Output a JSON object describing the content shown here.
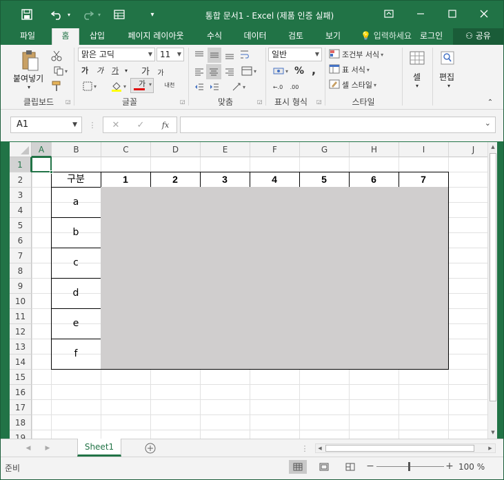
{
  "titlebar": {
    "title": "통합 문서1 - Excel (제품 인증 실패)",
    "icons": [
      "save-icon",
      "undo-icon",
      "redo-icon",
      "form-icon",
      "customize-icon",
      "ribbon-options-icon",
      "minimize-icon",
      "maximize-icon",
      "close-icon"
    ]
  },
  "tabs": [
    "파일",
    "홈",
    "삽입",
    "페이지 레이아웃",
    "수식",
    "데이터",
    "검토",
    "보기"
  ],
  "active_tab": "홈",
  "tell_me": "입력하세요",
  "login": "로그인",
  "share": "공유",
  "ribbon": {
    "clipboard": {
      "paste_label": "붙여넣기",
      "group_label": "클립보드"
    },
    "font": {
      "font_name": "맑은 고딕",
      "font_size": "11",
      "group_label": "글꼴",
      "bold": "가",
      "italic": "가",
      "underline": "가",
      "grow": "가",
      "shrink": "가",
      "font_color_label": "가",
      "phonetic": "내천"
    },
    "alignment": {
      "group_label": "맞춤"
    },
    "number": {
      "format": "일반",
      "percent": "%",
      "comma": ",",
      "inc_decimal": "←.0",
      "dec_decimal": ".00",
      "group_label": "표시 형식"
    },
    "styles": {
      "conditional": "조건부 서식",
      "table": "표 서식",
      "cell": "셀 스타일",
      "group_label": "스타일"
    },
    "cells": {
      "label": "셀"
    },
    "editing": {
      "label": "편집"
    },
    "accent_color": "#217346",
    "font_color_bar": "#e00000"
  },
  "formula_bar": {
    "name_box": "A1",
    "cancel": "✕",
    "enter": "✓",
    "fx": "fx",
    "formula": ""
  },
  "grid": {
    "columns": [
      "A",
      "B",
      "C",
      "D",
      "E",
      "F",
      "G",
      "H",
      "I",
      "J"
    ],
    "rows": [
      "1",
      "2",
      "3",
      "4",
      "5",
      "6",
      "7",
      "8",
      "9",
      "10",
      "11",
      "12",
      "13",
      "14",
      "15",
      "16",
      "17",
      "18",
      "19"
    ],
    "selected_cell": "A1",
    "table": {
      "header_label": "구분",
      "header_numbers": [
        "1",
        "2",
        "3",
        "4",
        "5",
        "6",
        "7"
      ],
      "categories": [
        "a",
        "b",
        "c",
        "d",
        "e",
        "f"
      ],
      "shade_color": "#d0cece"
    }
  },
  "sheets": [
    "Sheet1"
  ],
  "active_sheet": "Sheet1",
  "status": {
    "text": "준비",
    "zoom": "100 %"
  }
}
